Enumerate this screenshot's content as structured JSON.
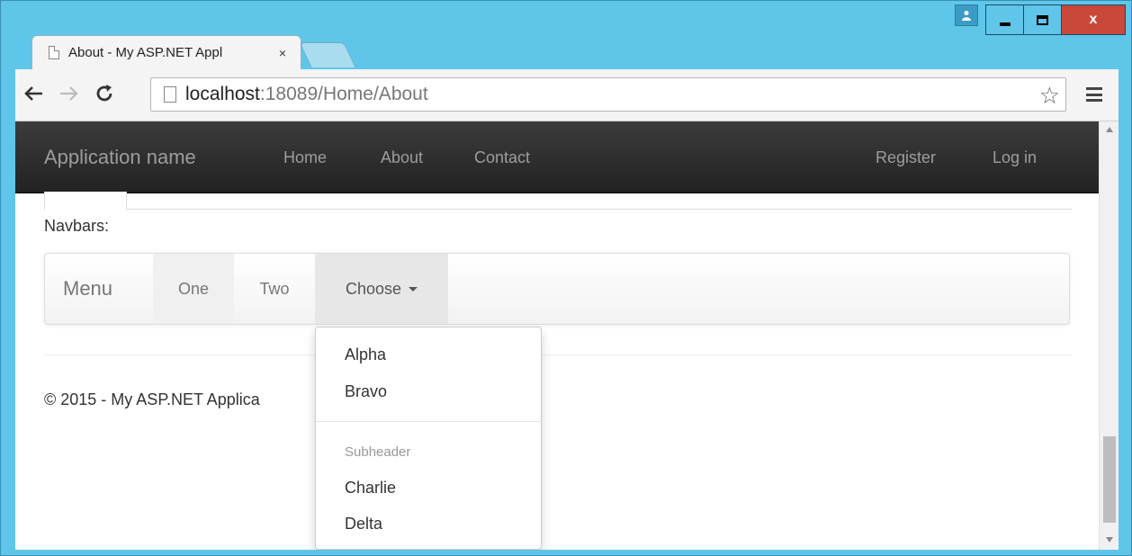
{
  "browser": {
    "tab_title": "About - My ASP.NET Appl",
    "tab_close": "×",
    "url_host": "localhost",
    "url_path": ":18089/Home/About",
    "window_close": "x"
  },
  "site_navbar": {
    "brand": "Application name",
    "links": [
      "Home",
      "About",
      "Contact"
    ],
    "right_links": [
      "Register",
      "Log in"
    ]
  },
  "content": {
    "section_label": "Navbars:",
    "demo_navbar": {
      "brand": "Menu",
      "items": [
        "One",
        "Two"
      ],
      "dropdown_label": "Choose"
    },
    "dropdown": {
      "items_top": [
        "Alpha",
        "Bravo"
      ],
      "header": "Subheader",
      "items_bottom": [
        "Charlie",
        "Delta"
      ]
    },
    "footer": "© 2015 - My ASP.NET Applica"
  },
  "colors": {
    "window_frame": "#5fc6ea",
    "close_button": "#c9483a",
    "navbar_bg": "#222222",
    "navbar_text": "#9d9d9d",
    "active_item_bg": "#e7e7e7"
  }
}
